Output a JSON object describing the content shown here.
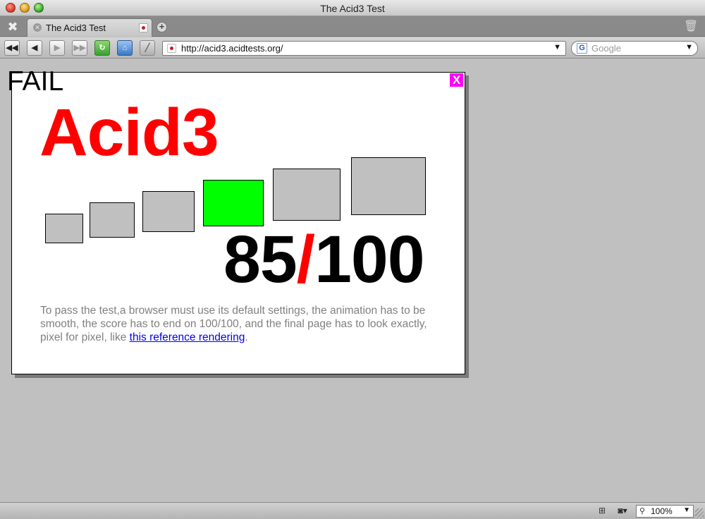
{
  "window": {
    "title": "The Acid3 Test"
  },
  "tabbar": {
    "tools_icon": "wrench-screwdriver-icon",
    "tabs": [
      {
        "label": "The Acid3 Test",
        "active": true
      }
    ],
    "new_tab_icon": "plus-icon",
    "trash_icon": "trash-icon"
  },
  "toolbar": {
    "buttons": [
      "rewind-icon",
      "back-icon",
      "forward-icon",
      "fast-forward-icon",
      "reload-icon",
      "home-icon",
      "edit-icon"
    ],
    "address": {
      "url": "http://acid3.acidtests.org/"
    },
    "search": {
      "placeholder": "Google",
      "engine_icon": "google-icon"
    }
  },
  "page": {
    "fail_text": "FAIL",
    "close_label": "X",
    "title": "Acid3",
    "score": {
      "value": "85",
      "separator": "/",
      "total": "100"
    },
    "buckets": [
      {
        "color": "#c0c0c0"
      },
      {
        "color": "#c0c0c0"
      },
      {
        "color": "#c0c0c0"
      },
      {
        "color": "#00ff00"
      },
      {
        "color": "#c0c0c0"
      },
      {
        "color": "#c0c0c0"
      }
    ],
    "instructions": {
      "text": "To pass the test,a browser must use its default settings, the animation has to be smooth, the score has to end on 100/100, and the final page has to look exactly, pixel for pixel, like ",
      "link_text": "this reference rendering",
      "suffix": "."
    }
  },
  "statusbar": {
    "zoom": "100%"
  },
  "colors": {
    "title_red": "#ff0000",
    "close_magenta": "#ff00ff",
    "bucket_gray": "#c0c0c0",
    "bucket_green": "#00ff00",
    "link_blue": "#0000ee",
    "page_background": "#c0c0c0"
  }
}
